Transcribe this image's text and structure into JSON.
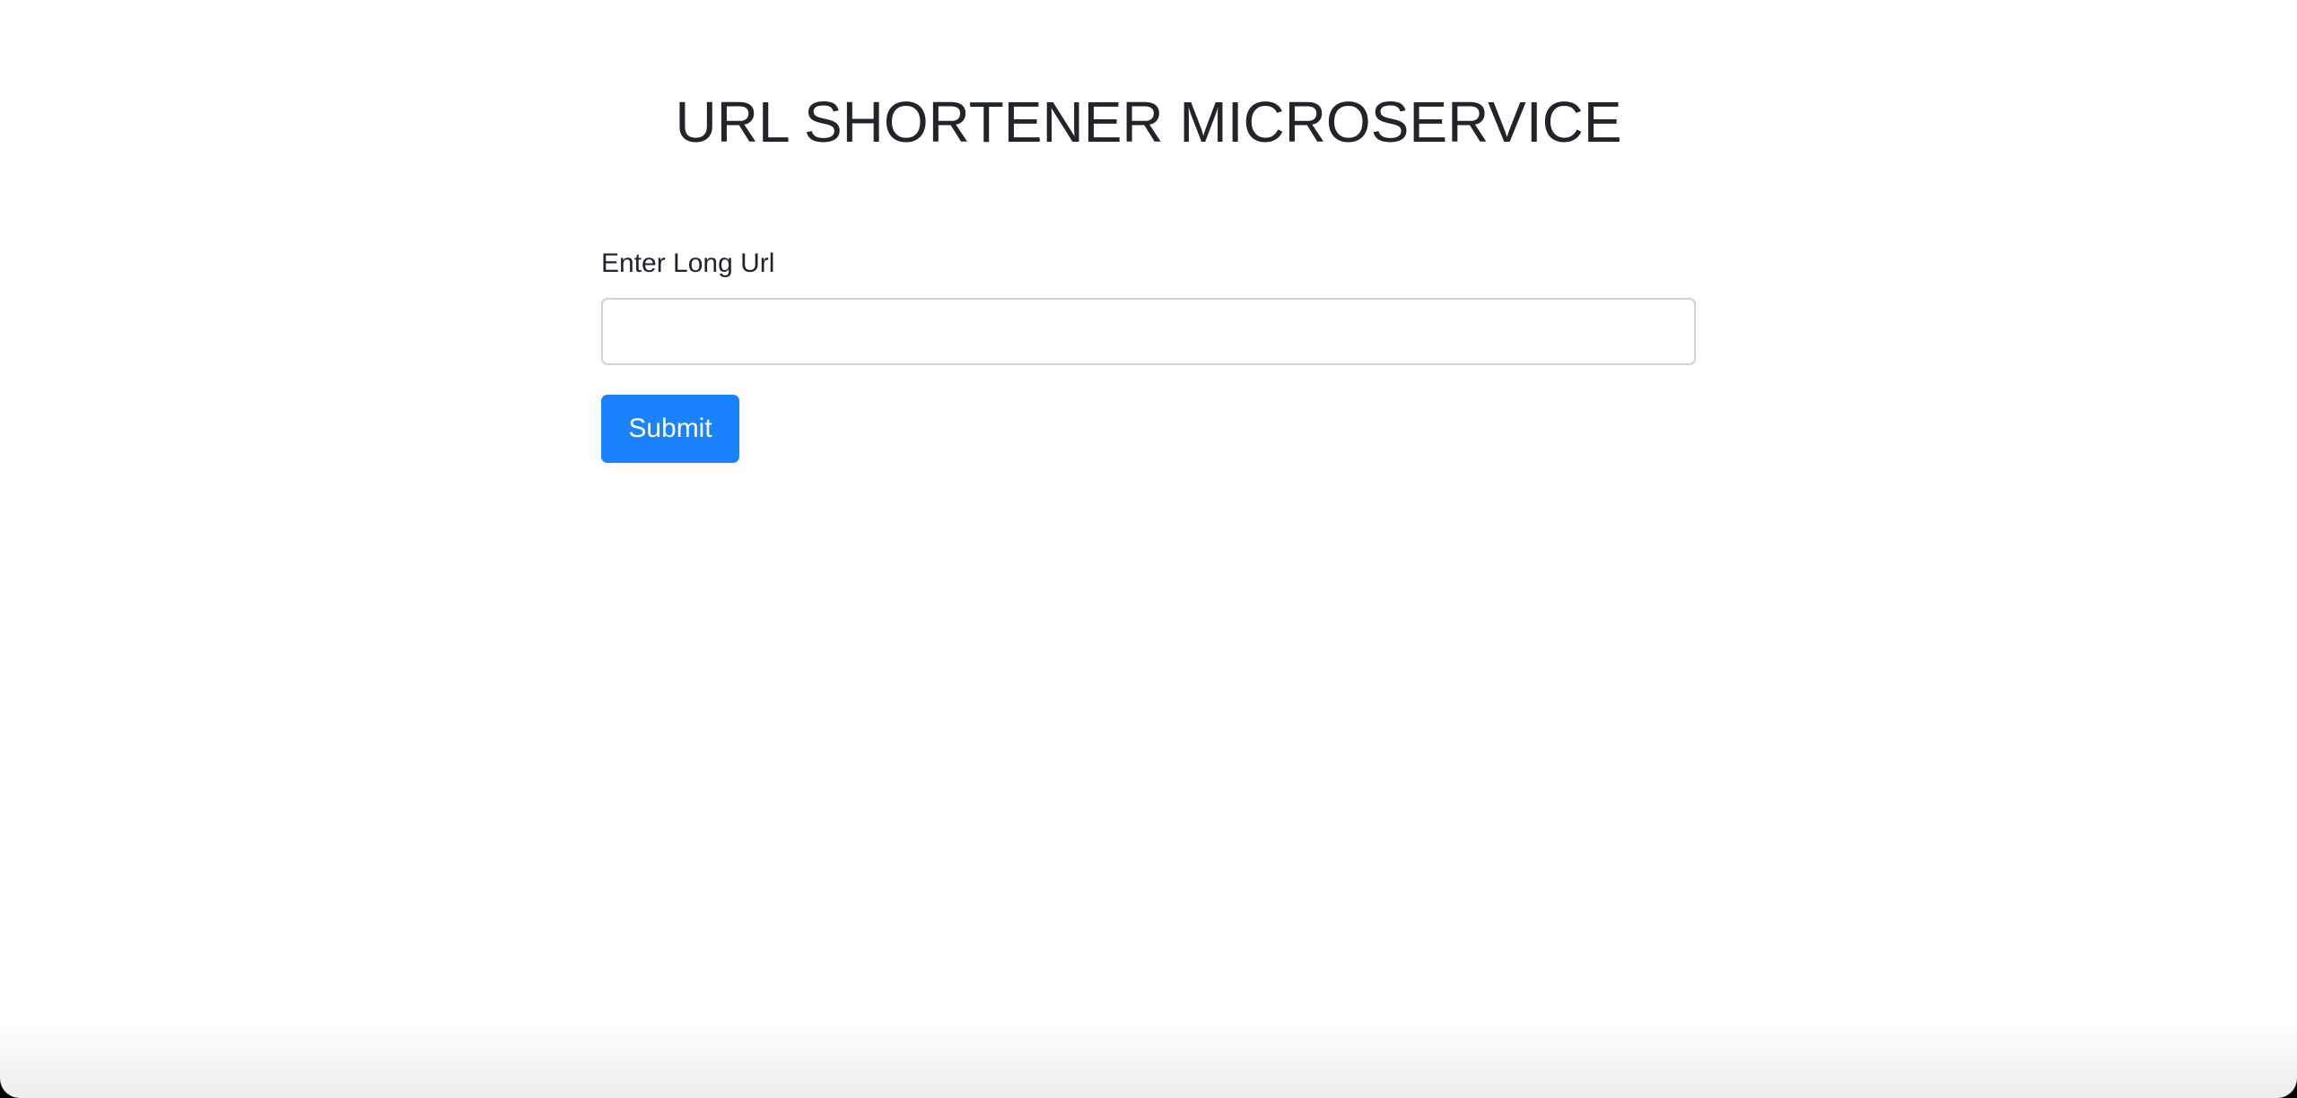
{
  "header": {
    "title": "URL SHORTENER MICROSERVICE"
  },
  "form": {
    "label": "Enter Long Url",
    "input_value": "",
    "input_placeholder": "",
    "submit_label": "Submit"
  },
  "colors": {
    "primary": "#1a82fb",
    "text": "#212529",
    "input_border": "#ced4da"
  }
}
